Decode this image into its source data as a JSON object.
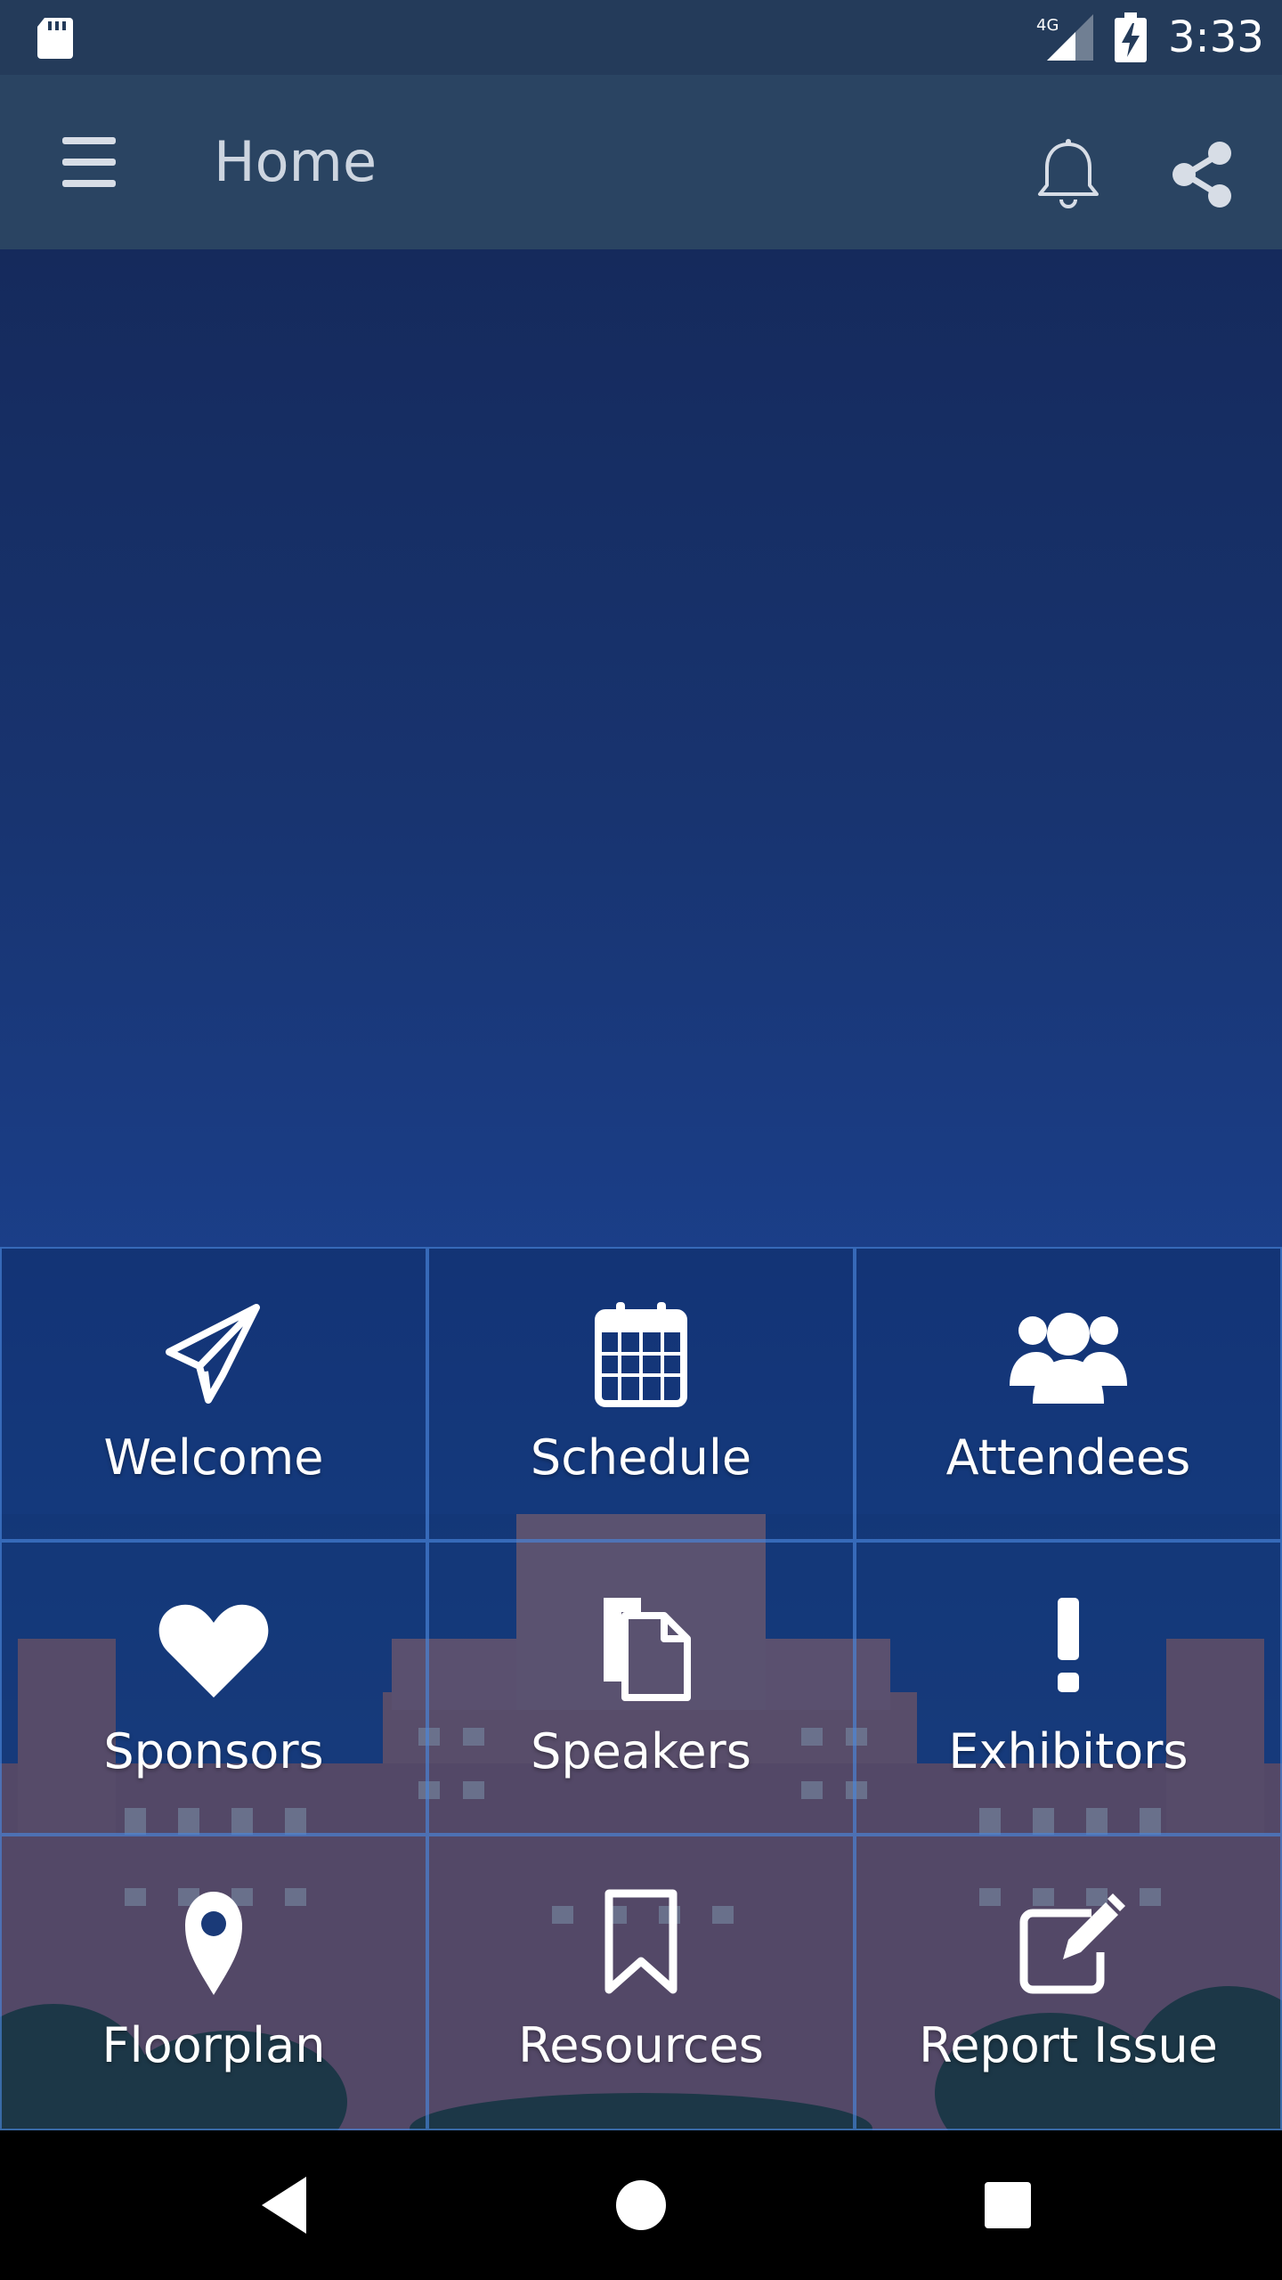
{
  "status_bar": {
    "time": "3:33",
    "network": "4G"
  },
  "app_bar": {
    "title": "Home"
  },
  "tiles": [
    {
      "label": "Welcome",
      "icon": "paper-plane-icon"
    },
    {
      "label": "Schedule",
      "icon": "calendar-icon"
    },
    {
      "label": "Attendees",
      "icon": "users-icon"
    },
    {
      "label": "Sponsors",
      "icon": "heart-icon"
    },
    {
      "label": "Speakers",
      "icon": "documents-icon"
    },
    {
      "label": "Exhibitors",
      "icon": "exclamation-icon"
    },
    {
      "label": "Floorplan",
      "icon": "map-marker-icon"
    },
    {
      "label": "Resources",
      "icon": "bookmark-icon"
    },
    {
      "label": "Report Issue",
      "icon": "edit-icon"
    }
  ],
  "colors": {
    "status_bar": "#243b5a",
    "app_bar": "#2a4462",
    "content_top": "#152a5c",
    "tile_border": "#4a86dc"
  }
}
